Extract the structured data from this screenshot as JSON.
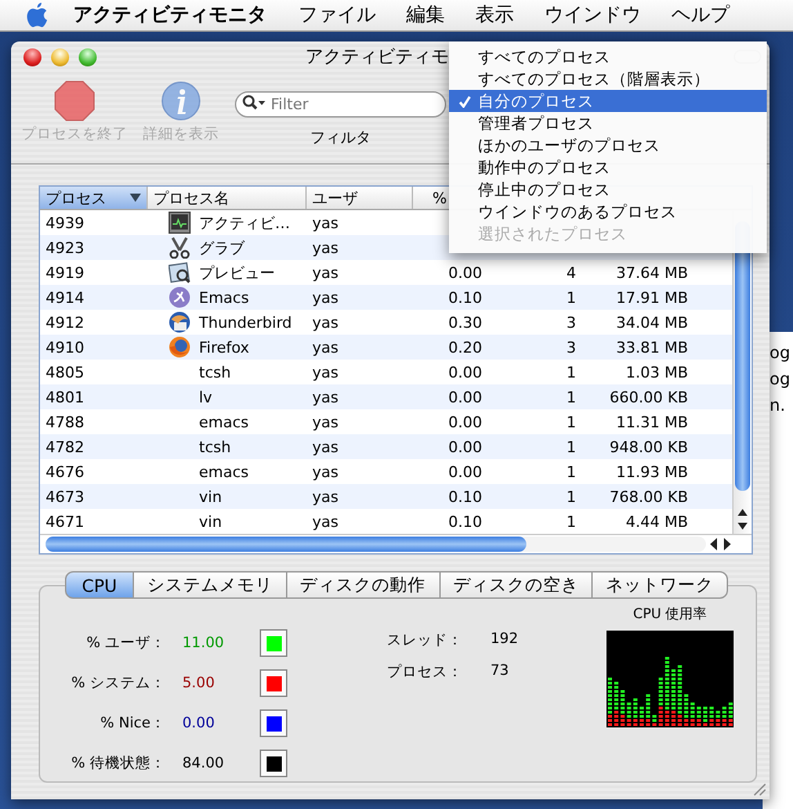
{
  "menu_bar": {
    "app": "アクティビティモニタ",
    "items": [
      "ファイル",
      "編集",
      "表示",
      "ウインドウ",
      "ヘルプ"
    ]
  },
  "window": {
    "title": "アクティビティモ"
  },
  "toolbar": {
    "buttons": [
      {
        "kind": "stop",
        "label": "プロセスを終了",
        "disabled": true
      },
      {
        "kind": "info",
        "label": "詳細を表示",
        "disabled": true
      }
    ],
    "search": {
      "placeholder": "Filter",
      "label": "フィルタ"
    }
  },
  "table": {
    "columns": [
      {
        "label": "プロセス",
        "selected": true
      },
      {
        "label": "プロセス名",
        "selected": false
      },
      {
        "label": "ユーザ",
        "selected": false
      },
      {
        "label": "%",
        "selected": false
      }
    ],
    "rows": [
      {
        "pid": "4939",
        "kind": "monitor",
        "name": "アクティビ…",
        "user": "yas"
      },
      {
        "pid": "4923",
        "kind": "grab",
        "name": "グラブ",
        "user": "yas"
      },
      {
        "pid": "4919",
        "kind": "preview",
        "name": "プレビュー",
        "user": "yas",
        "cpu": "0.00",
        "threads": "4",
        "memory": "37.64 MB"
      },
      {
        "pid": "4914",
        "kind": "emacs",
        "name": "Emacs",
        "user": "yas",
        "cpu": "0.10",
        "threads": "1",
        "memory": "17.91 MB"
      },
      {
        "pid": "4912",
        "kind": "thunderbird",
        "name": "Thunderbird",
        "user": "yas",
        "cpu": "0.30",
        "threads": "3",
        "memory": "34.04 MB"
      },
      {
        "pid": "4910",
        "kind": "firefox",
        "name": "Firefox",
        "user": "yas",
        "cpu": "0.20",
        "threads": "3",
        "memory": "33.81 MB"
      },
      {
        "pid": "4805",
        "name": "tcsh",
        "user": "yas",
        "cpu": "0.00",
        "threads": "1",
        "memory": "1.03 MB"
      },
      {
        "pid": "4801",
        "name": "lv",
        "user": "yas",
        "cpu": "0.00",
        "threads": "1",
        "memory": "660.00 KB"
      },
      {
        "pid": "4788",
        "name": "emacs",
        "user": "yas",
        "cpu": "0.00",
        "threads": "1",
        "memory": "11.31 MB"
      },
      {
        "pid": "4782",
        "name": "tcsh",
        "user": "yas",
        "cpu": "0.00",
        "threads": "1",
        "memory": "948.00 KB"
      },
      {
        "pid": "4676",
        "name": "emacs",
        "user": "yas",
        "cpu": "0.00",
        "threads": "1",
        "memory": "11.93 MB"
      },
      {
        "pid": "4673",
        "name": "vin",
        "user": "yas",
        "cpu": "0.10",
        "threads": "1",
        "memory": "768.00 KB"
      },
      {
        "pid": "4671",
        "name": "vin",
        "user": "yas",
        "cpu": "0.10",
        "threads": "1",
        "memory": "4.44 MB"
      }
    ]
  },
  "process_menu": {
    "items": [
      {
        "label": "すべてのプロセス",
        "selected": false,
        "disabled": false
      },
      {
        "label": "すべてのプロセス（階層表示）",
        "selected": false,
        "disabled": false
      },
      {
        "label": "自分のプロセス",
        "selected": true,
        "disabled": false
      },
      {
        "label": "管理者プロセス",
        "selected": false,
        "disabled": false
      },
      {
        "label": "ほかのユーザのプロセス",
        "selected": false,
        "disabled": false
      },
      {
        "label": "動作中のプロセス",
        "selected": false,
        "disabled": false
      },
      {
        "label": "停止中のプロセス",
        "selected": false,
        "disabled": false
      },
      {
        "label": "ウインドウのあるプロセス",
        "selected": false,
        "disabled": false
      },
      {
        "label": "選択されたプロセス",
        "selected": false,
        "disabled": true
      }
    ]
  },
  "tabs": [
    {
      "label": "CPU",
      "selected": true
    },
    {
      "label": "システムメモリ",
      "selected": false
    },
    {
      "label": "ディスクの動作",
      "selected": false
    },
    {
      "label": "ディスクの空き",
      "selected": false
    },
    {
      "label": "ネットワーク",
      "selected": false
    }
  ],
  "cpu_stats": [
    {
      "label": "% ユーザ：",
      "value": "11.00",
      "color": "#00ff00"
    },
    {
      "label": "% システム：",
      "value": "5.00",
      "color": "#ff0000"
    },
    {
      "label": "% Nice：",
      "value": "0.00",
      "color": "#0000ff"
    },
    {
      "label": "% 待機状態：",
      "value": "84.00",
      "color": "#000000"
    }
  ],
  "counts": [
    {
      "label": "スレッド：",
      "value": "192"
    },
    {
      "label": "プロセス：",
      "value": "73"
    }
  ],
  "cpu_graph": {
    "title": "CPU 使用率"
  },
  "background_window": {
    "fragments": [
      "og",
      "og",
      "n."
    ]
  }
}
